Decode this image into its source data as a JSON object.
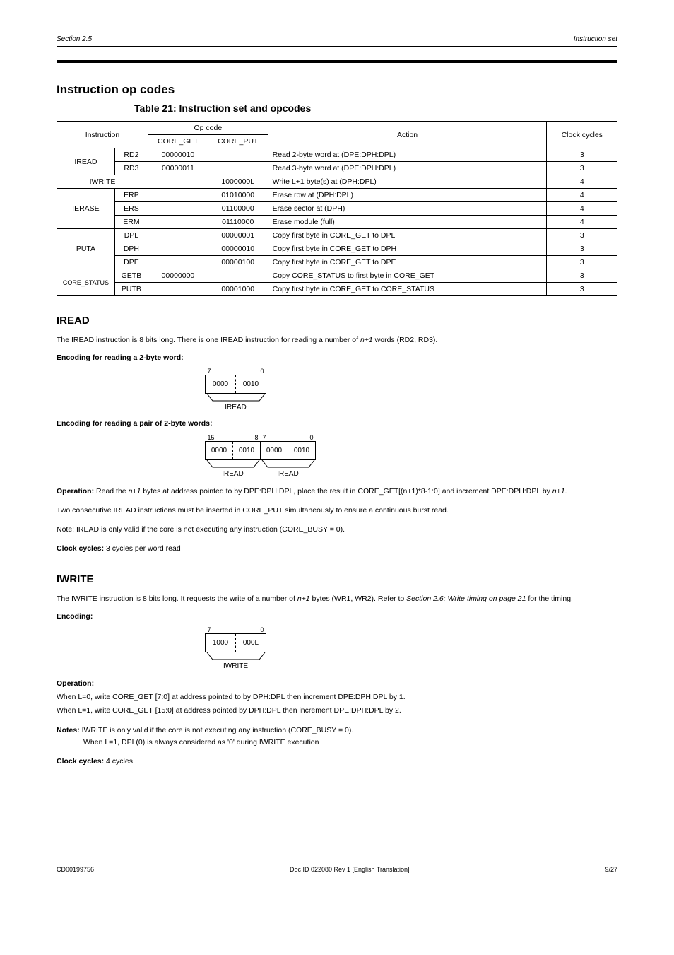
{
  "header": {
    "left": "Section 2.5",
    "right": "Instruction set"
  },
  "section_title": "Instruction op codes",
  "table_caption": "Table 21: Instruction set and opcodes",
  "table": {
    "headers": {
      "instruction": "Instruction",
      "opcode": "Op code",
      "get": "CORE_GET",
      "put": "CORE_PUT",
      "action": "Action",
      "clock": "Clock cycles"
    },
    "rows": [
      {
        "inst": "IREAD",
        "sub": "RD2",
        "get": "00000010",
        "put": "",
        "action": "Read 2-byte word at (DPE:DPH:DPL)",
        "clock": "3"
      },
      {
        "inst": "",
        "sub": "RD3",
        "get": "00000011",
        "put": "",
        "action": "Read 3-byte word at (DPE:DPH:DPL)",
        "clock": "3"
      },
      {
        "inst": "IWRITE",
        "sub": "",
        "get": "",
        "put": "1000000L",
        "action": "Write L+1 byte(s) at (DPH:DPL)",
        "clock": "4"
      },
      {
        "inst": "IERASE",
        "sub": "ERP",
        "get": "",
        "put": "01010000",
        "action": "Erase row at (DPH:DPL)",
        "clock": "4"
      },
      {
        "inst": "",
        "sub": "ERS",
        "get": "",
        "put": "01100000",
        "action": "Erase sector at (DPH)",
        "clock": "4"
      },
      {
        "inst": "",
        "sub": "ERM",
        "get": "",
        "put": "01110000",
        "action": "Erase module (full)",
        "clock": "4"
      },
      {
        "inst": "PUTA",
        "sub": "DPL",
        "get": "",
        "put": "00000001",
        "action": "Copy first byte in CORE_GET to DPL",
        "clock": "3"
      },
      {
        "inst": "",
        "sub": "DPH",
        "get": "",
        "put": "00000010",
        "action": "Copy first byte in CORE_GET to DPH",
        "clock": "3"
      },
      {
        "inst": "",
        "sub": "DPE",
        "get": "",
        "put": "00000100",
        "action": "Copy first byte in CORE_GET to DPE",
        "clock": "3"
      },
      {
        "inst": "CORE_STATUS",
        "sub": "GETB",
        "get": "00000000",
        "put": "",
        "action": "Copy CORE_STATUS to first byte in CORE_GET",
        "clock": "3"
      },
      {
        "inst": "",
        "sub": "PUTB",
        "get": "",
        "put": "00001000",
        "action": "Copy first byte in CORE_GET to CORE_STATUS",
        "clock": "3"
      }
    ]
  },
  "iread": {
    "title": "IREAD",
    "intro_part1": "The IREAD instruction is 8 bits long. There is one IREAD instruction for reading a number of ",
    "intro_part2": " words (RD2, RD3).",
    "italic1": "n+1",
    "enc1_label": "Encoding for reading a 2-byte word:",
    "enc1": {
      "left_bit": "7",
      "right_bit": "0",
      "left_val": "0000",
      "right_val": "0010",
      "brace": "IREAD"
    },
    "enc2_label": "Encoding for reading a pair of 2-byte words:",
    "enc2": {
      "bits": [
        "15",
        "8",
        "7",
        "0"
      ],
      "vals": [
        "0000",
        "0010",
        "0000",
        "0010"
      ],
      "braces": [
        "IREAD",
        "IREAD"
      ]
    },
    "operation_label": "Operation:",
    "op_line1_a": "Read the ",
    "op_line1_b": " bytes at address pointed to by DPE:DPH:DPL, place the result in CORE_GET[(n+1)*8-1:0] and increment DPE:DPH:DPL by ",
    "n_plus_1": "n+1",
    "op_line2": "Two consecutive IREAD instructions must be inserted in CORE_PUT simultaneously to ensure a continuous burst read.",
    "op_line3": "Note: IREAD is only valid if the core is not executing any instruction (CORE_BUSY = 0).",
    "cycles_label": "Clock cycles:",
    "cycles": "3 cycles per word read"
  },
  "iwrite": {
    "title": "IWRITE",
    "intro_part1": "The IWRITE instruction is 8 bits long. It requests the write of a number of ",
    "intro_part2": " bytes (WR1, WR2). Refer to ",
    "intro_part3": " for the timing.",
    "italic1": "n+1",
    "italic_ref": "Section 2.6: Write timing on page 21",
    "enc_label": "Encoding:",
    "enc": {
      "left_bit": "7",
      "right_bit": "0",
      "left_val": "1000",
      "right_val": "000L",
      "brace": "IWRITE"
    },
    "operation_label": "Operation:",
    "op_a": "When L=0, write CORE_GET [7:0] at address pointed to by DPH:DPL then increment DPE:DPH:DPL by 1.",
    "op_b": "When L=1, write CORE_GET [15:0] at address pointed by DPH:DPL then increment DPE:DPH:DPL by 2.",
    "notes_label": "Notes:",
    "note1": "IWRITE is only valid if the core is not executing any instruction (CORE_BUSY = 0).",
    "note2": "When L=1, DPL(0) is always considered as '0' during IWRITE execution",
    "cycles_label": "Clock cycles:",
    "cycles": "4 cycles"
  },
  "footer": {
    "left": "CD00199756",
    "center": "Doc ID 022080 Rev 1 [English Translation]",
    "right": "9/27"
  }
}
